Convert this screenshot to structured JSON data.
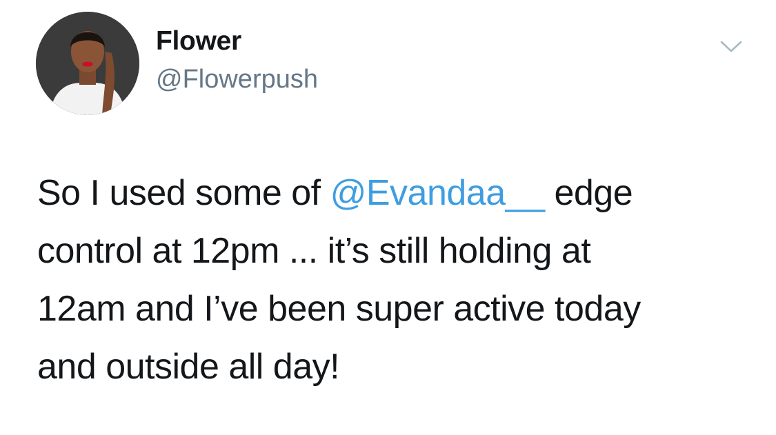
{
  "tweet": {
    "author": {
      "display_name": "Flower",
      "handle": "@Flowerpush",
      "avatar_icon": "profile-photo"
    },
    "menu_icon": "chevron-down-icon",
    "colors": {
      "text": "#14171a",
      "handle": "#657786",
      "mention": "#3f9de0",
      "background": "#ffffff"
    },
    "text": {
      "line1_before": "So I used some of ",
      "line1_mention": "@Evandaa__",
      "line1_after": " edge",
      "line2": "control at 12pm ... it’s still holding at",
      "line3": "12am and I’ve been super active today",
      "line4": "and outside all day!"
    }
  }
}
